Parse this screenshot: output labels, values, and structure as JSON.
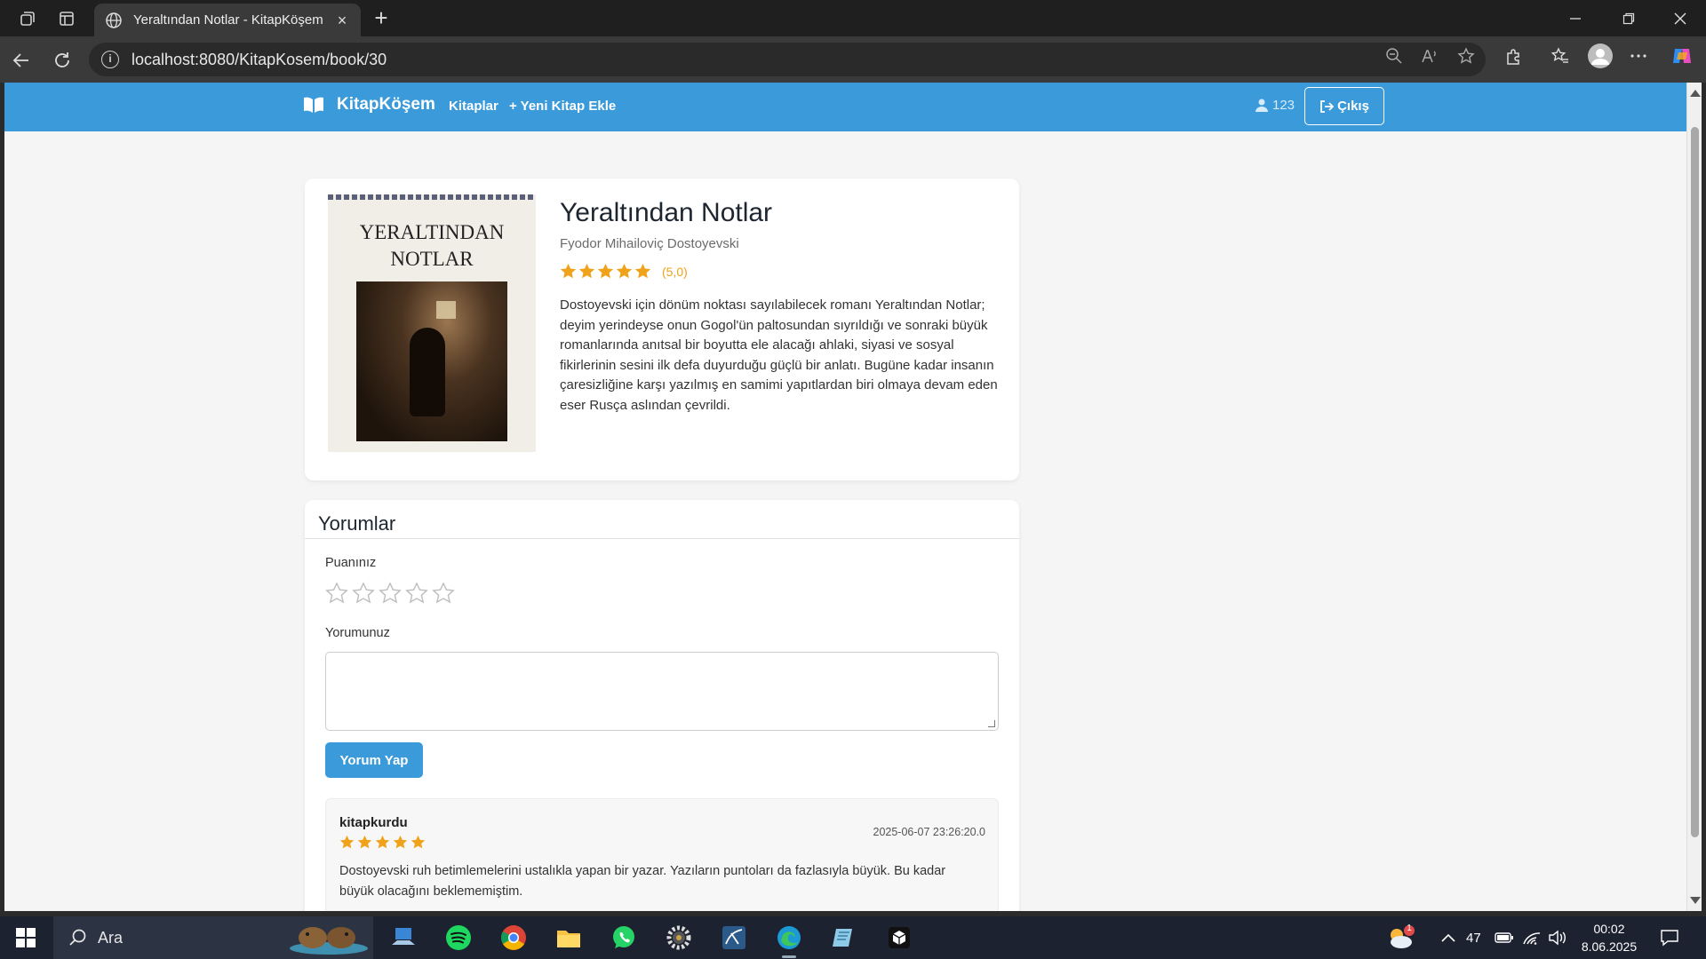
{
  "browser": {
    "tab_title": "Yeraltından Notlar - KitapKöşem",
    "url": "localhost:8080/KitapKosem/book/30"
  },
  "navbar": {
    "brand": "KitapKöşem",
    "links": [
      "Kitaplar",
      "+ Yeni Kitap Ekle"
    ],
    "user": "123",
    "logout": "Çıkış",
    "color": "#3b9ad9"
  },
  "book": {
    "cover_title_line1": "YERALTINDAN",
    "cover_title_line2": "NOTLAR",
    "title": "Yeraltından Notlar",
    "author": "Fyodor Mihailoviç Dostoyevski",
    "rating": 5,
    "rating_text": "(5,0)",
    "description": "Dostoyevski için dönüm noktası sayılabilecek romanı Yeraltından Notlar; deyim yerindeyse onun Gogol'ün paltosundan sıyrıldığı ve sonraki büyük romanlarında anıtsal bir boyutta ele alacağı ahlaki, siyasi ve sosyal fikirlerinin sesini ilk defa duyurduğu güçlü bir anlatı. Bugüne kadar insanın çaresizliğine karşı yazılmış en samimi yapıtlardan biri olmaya devam eden eser Rusça aslından çevrildi."
  },
  "reviews": {
    "heading": "Yorumlar",
    "rating_label": "Puanınız",
    "comment_label": "Yorumunuz",
    "submit_label": "Yorum Yap",
    "items": [
      {
        "user": "kitapkurdu",
        "rating": 5,
        "date": "2025-06-07 23:26:20.0",
        "text": "Dostoyevski ruh betimlemelerini ustalıkla yapan bir yazar. Yazıların puntoları da fazlasıyla büyük. Bu kadar büyük olacağını beklememiştim."
      }
    ]
  },
  "taskbar": {
    "search_label": "Ara",
    "temperature": "47",
    "time": "00:02",
    "date": "8.06.2025",
    "weather_badge": "1"
  }
}
